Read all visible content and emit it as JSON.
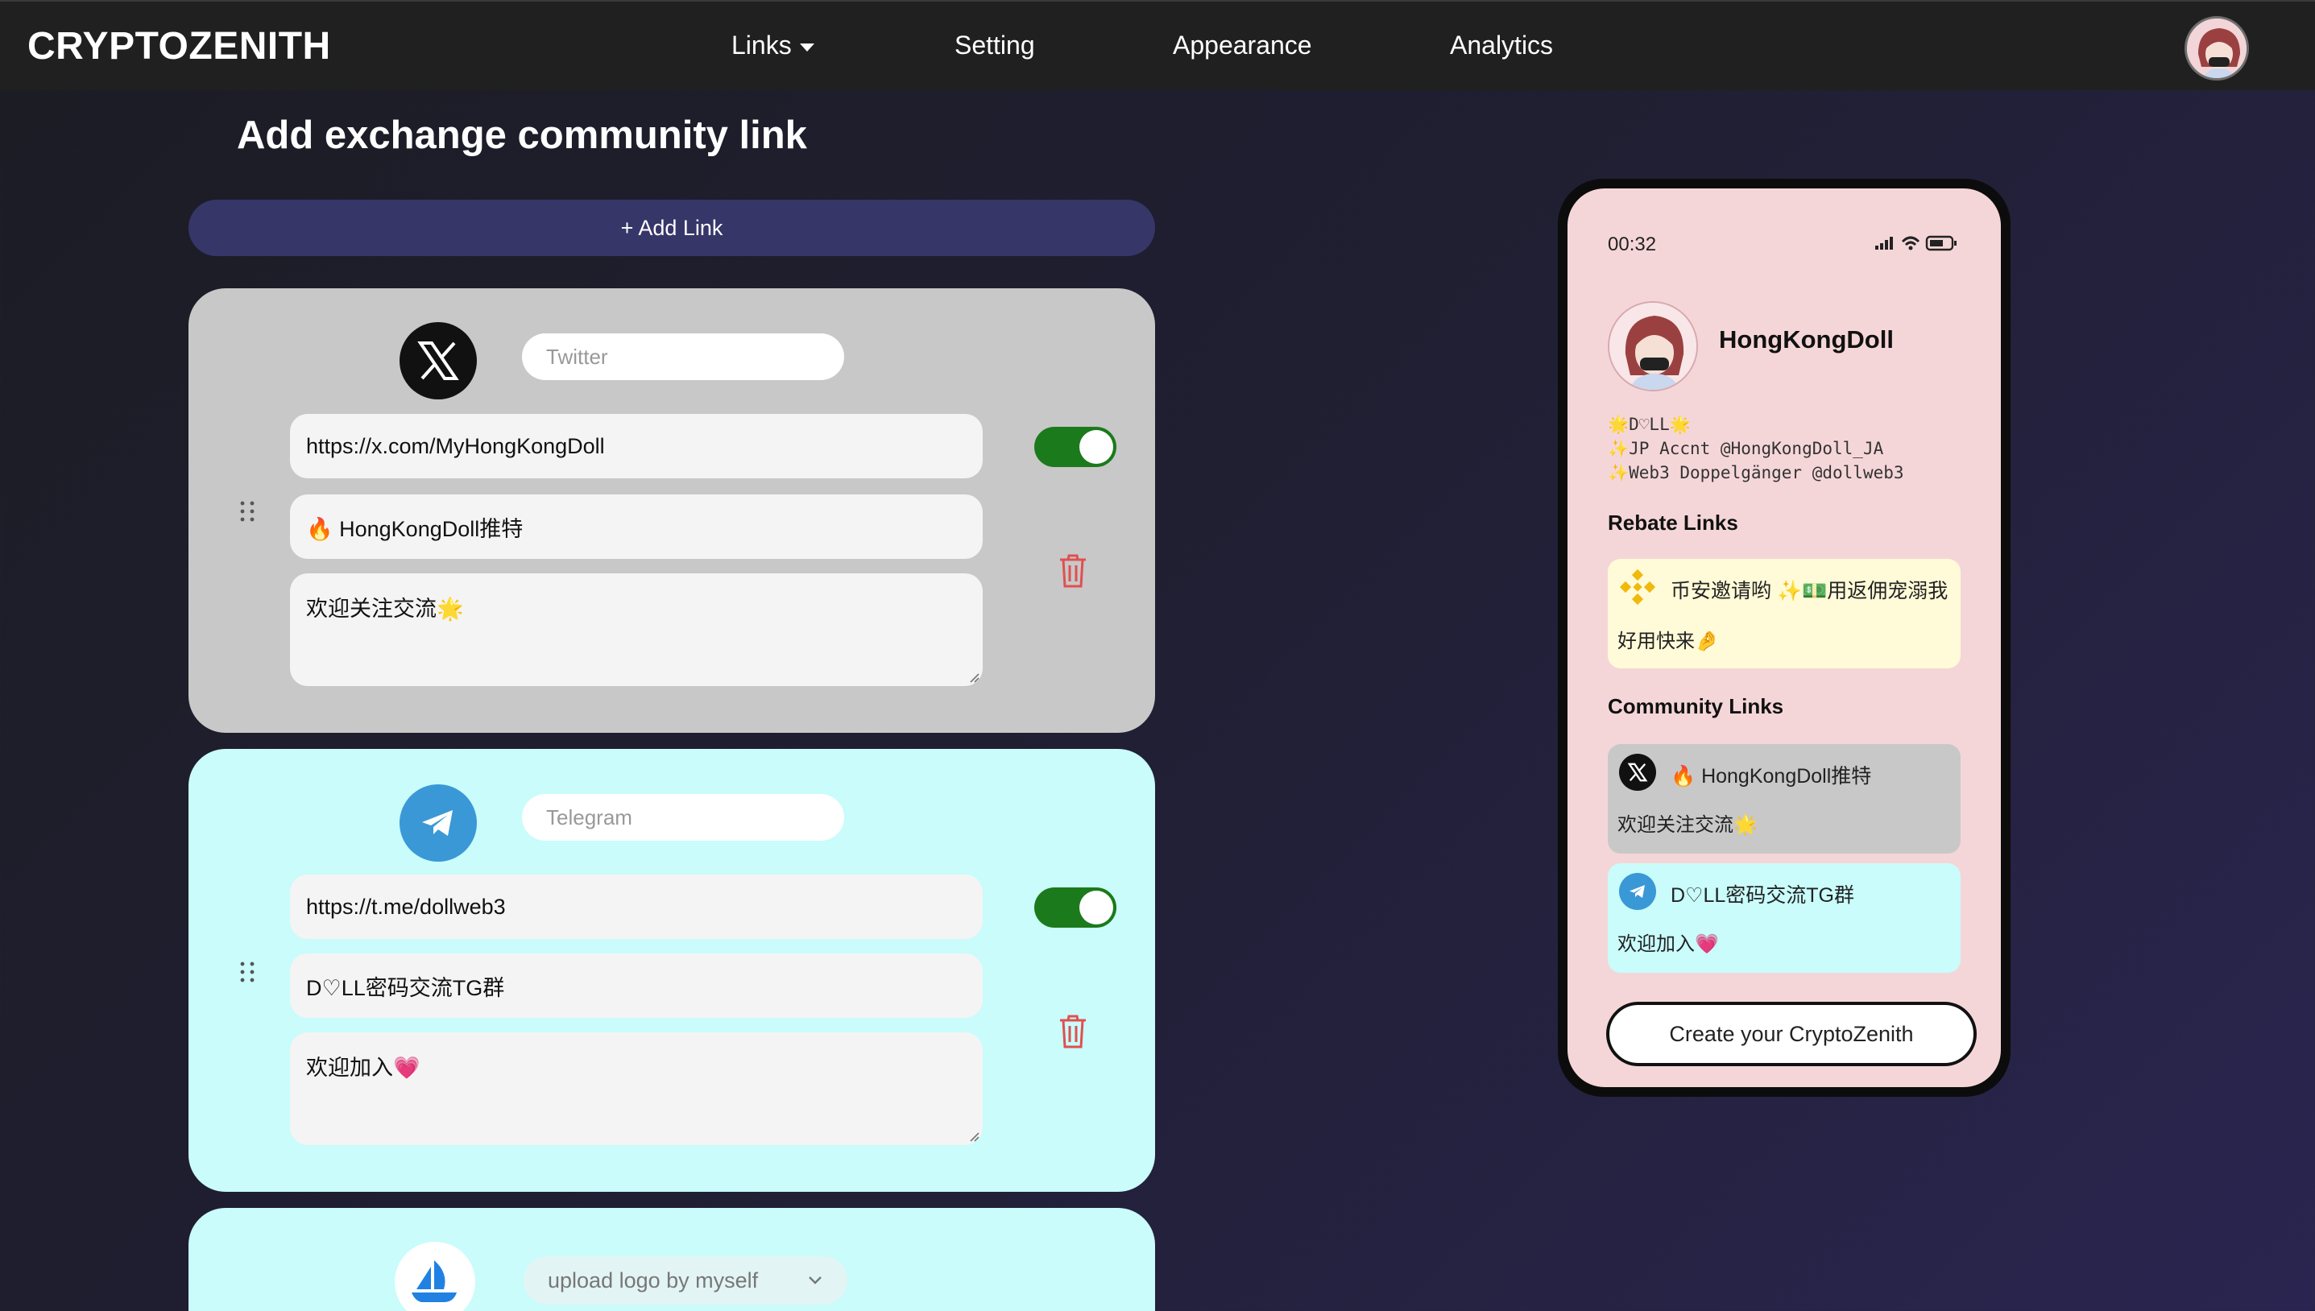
{
  "nav": {
    "brand": "CRYPTOZENITH",
    "items": [
      {
        "label": "Links"
      },
      {
        "label": "Setting"
      },
      {
        "label": "Appearance"
      },
      {
        "label": "Analytics"
      }
    ]
  },
  "editor": {
    "title": "Add exchange community link",
    "add_button": "+ Add Link",
    "cards": [
      {
        "name_value": "Twitter",
        "url": "https://x.com/MyHongKongDoll",
        "link_title": "🔥 HongKongDoll推特",
        "description": "欢迎关注交流🌟",
        "enabled": true,
        "logo": "x-logo-icon"
      },
      {
        "name_value": "Telegram",
        "url": "https://t.me/dollweb3",
        "link_title": "D♡LL密码交流TG群",
        "description": "欢迎加入💗",
        "enabled": true,
        "logo": "telegram-logo-icon"
      },
      {
        "select_value": "upload logo by myself",
        "logo": "opensea-logo-icon"
      }
    ]
  },
  "preview": {
    "time": "00:32",
    "username": "HongKongDoll",
    "bio": [
      "🌟D♡LL🌟",
      "✨JP Accnt @HongKongDoll_JA",
      "✨Web3 Doppelgänger @dollweb3"
    ],
    "rebate_title": "Rebate Links",
    "rebate": {
      "line1": "币安邀请哟 ✨💵用返佣宠溺我",
      "line2": "好用快来🤌",
      "icon": "binance-logo-icon"
    },
    "community_title": "Community Links",
    "community": [
      {
        "line1": "🔥 HongKongDoll推特",
        "line2": "欢迎关注交流🌟",
        "icon": "x-logo-icon"
      },
      {
        "line1": "D♡LL密码交流TG群",
        "line2": "欢迎加入💗",
        "icon": "telegram-logo-icon"
      }
    ],
    "create_button": "Create your CryptoZenith"
  },
  "colors": {
    "twitter_card": "#c8c8c8",
    "telegram_card": "#c9fcfb",
    "toggle_on": "#1b7a1b",
    "trash": "#e05050",
    "add_button": "#373669",
    "phone_bg": "#f5d6d8",
    "rebate_card": "#fffbd8"
  }
}
